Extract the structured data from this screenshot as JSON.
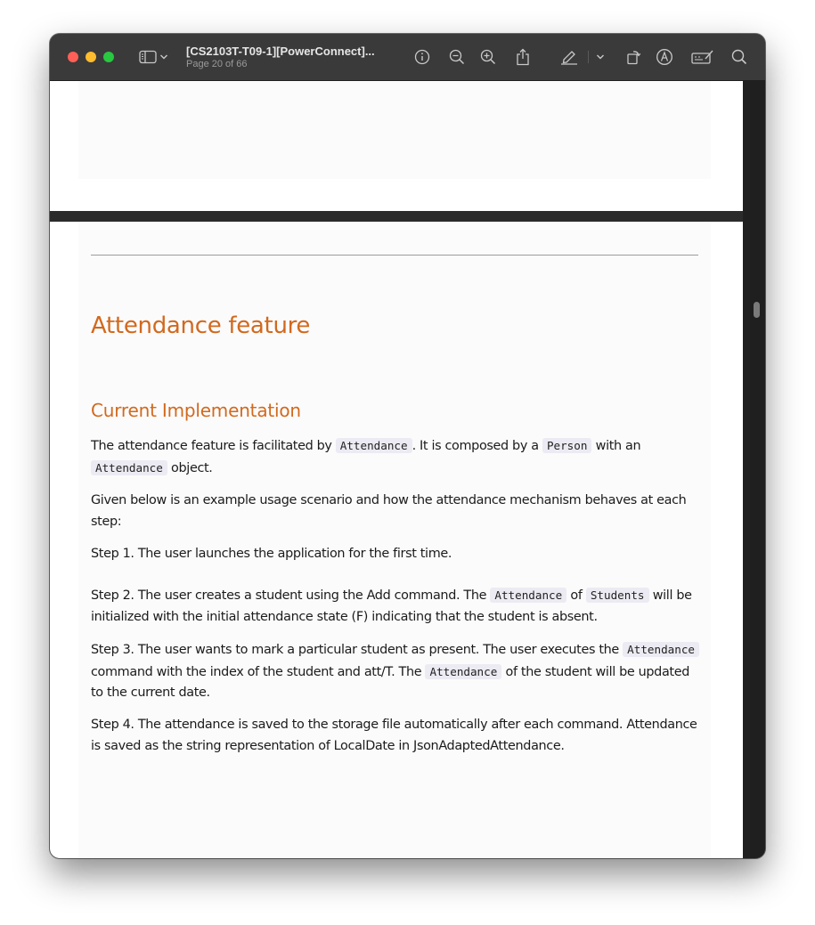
{
  "window": {
    "title": "[CS2103T-T09-1][PowerConnect]...",
    "subtitle": "Page 20 of 66"
  },
  "toolbar": {
    "icons": [
      "sidebar-icon",
      "chevron-down-icon",
      "info-icon",
      "zoom-out-icon",
      "zoom-in-icon",
      "share-icon",
      "highlight-pen-icon",
      "chevron-down-icon",
      "rotate-icon",
      "markup-icon",
      "annotate-icon",
      "search-icon"
    ]
  },
  "document": {
    "heading": "Attendance feature",
    "subheading": "Current Implementation",
    "p1": {
      "a": "The attendance feature is facilitated by ",
      "code1": "Attendance",
      "b": ". It is composed by a ",
      "code2": "Person",
      "c": " with an ",
      "code3": "Attendance",
      "d": " object."
    },
    "p2": "Given below is an example usage scenario and how the attendance mechanism behaves at each step:",
    "p3": "Step 1. The user launches the application for the first time.",
    "p4": {
      "a": "Step 2. The user creates a student using the Add command. The ",
      "code1": "Attendance",
      "b": " of ",
      "code2": "Students",
      "c": " will be initialized with the initial attendance state (F) indicating that the student is absent."
    },
    "p5": {
      "a": "Step 3. The user wants to mark a particular student as present. The user executes the ",
      "code1": "Attendance",
      "b": " command with the index of the student and att/T. The ",
      "code2": "Attendance",
      "c": " of the student will be updated to the current date."
    },
    "p6": "Step 4. The attendance is saved to the storage file automatically after each command. Attendance is saved as the string representation of LocalDate in JsonAdaptedAttendance."
  },
  "colors": {
    "heading": "#d2691e",
    "code_bg": "#ecebf3",
    "toolbar_bg": "#3a3a3a"
  }
}
